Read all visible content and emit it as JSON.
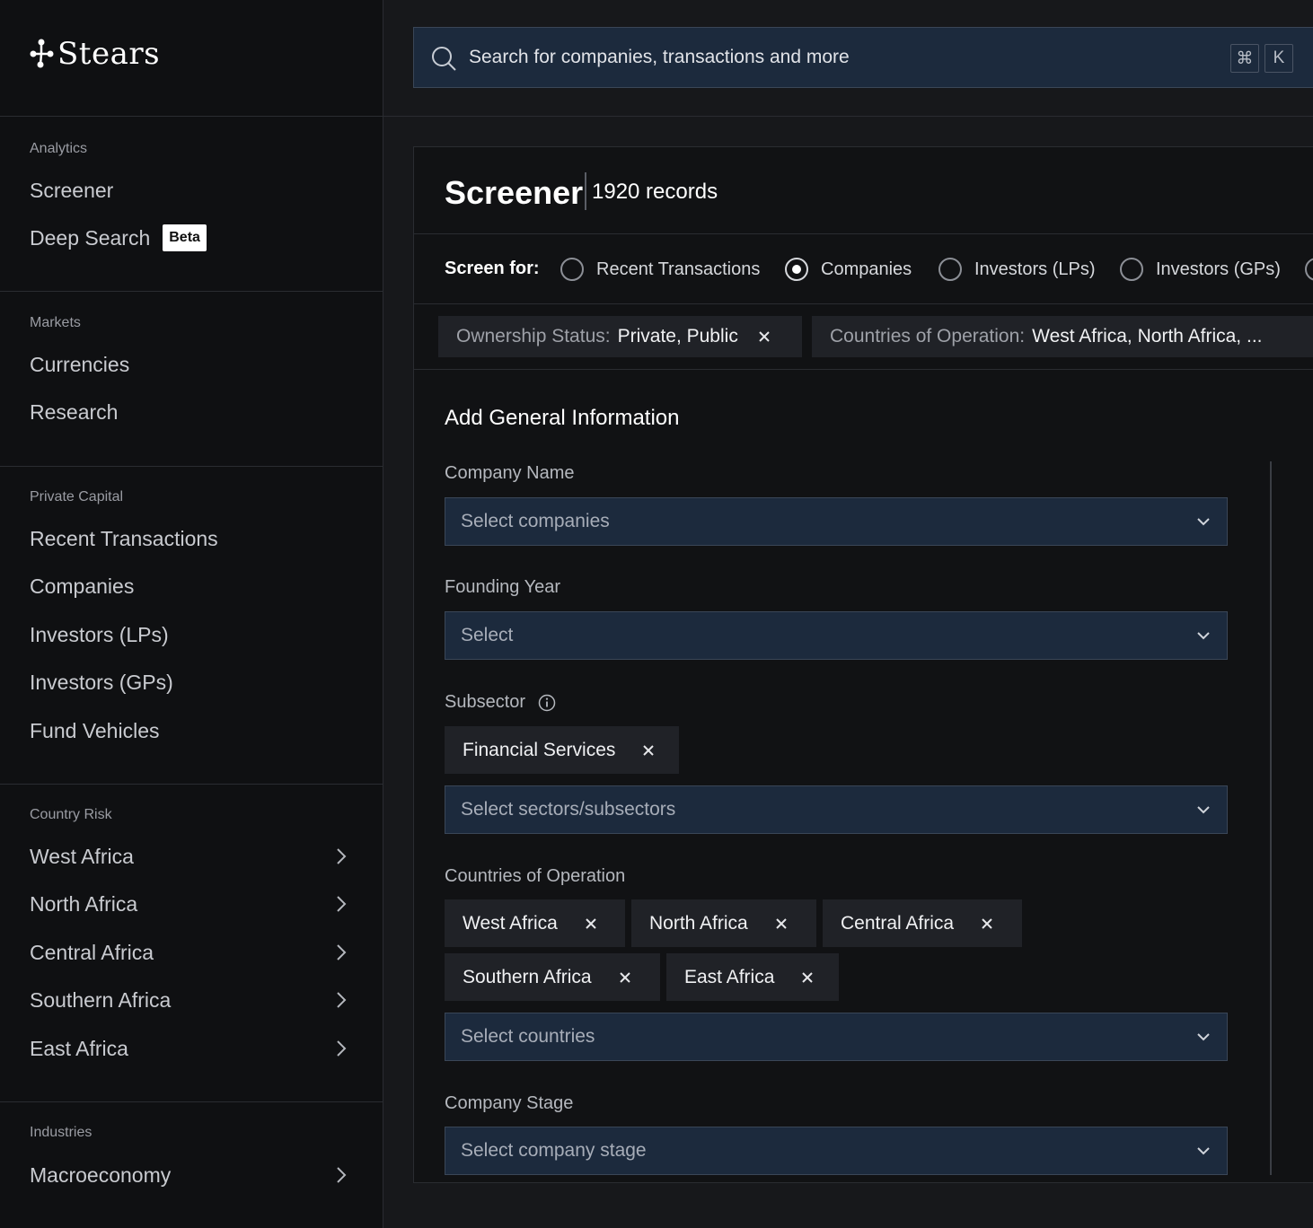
{
  "brand": {
    "name": "Stears"
  },
  "sidebar": {
    "sections": [
      {
        "label": "Analytics",
        "items": [
          {
            "label": "Screener"
          },
          {
            "label": "Deep Search",
            "badge": "Beta"
          }
        ]
      },
      {
        "label": "Markets",
        "items": [
          {
            "label": "Currencies"
          },
          {
            "label": "Research"
          }
        ]
      },
      {
        "label": "Private Capital",
        "items": [
          {
            "label": "Recent Transactions"
          },
          {
            "label": "Companies"
          },
          {
            "label": "Investors (LPs)"
          },
          {
            "label": "Investors (GPs)"
          },
          {
            "label": "Fund Vehicles"
          }
        ]
      },
      {
        "label": "Country Risk",
        "items": [
          {
            "label": "West Africa",
            "icon": "chevron-right-icon"
          },
          {
            "label": "North Africa",
            "icon": "chevron-right-icon"
          },
          {
            "label": "Central Africa",
            "icon": "chevron-right-icon"
          },
          {
            "label": "Southern Africa",
            "icon": "chevron-right-icon"
          },
          {
            "label": "East Africa",
            "icon": "chevron-right-icon"
          }
        ]
      },
      {
        "label": "Industries",
        "items": [
          {
            "label": "Macroeconomy",
            "icon": "chevron-right-icon"
          }
        ]
      }
    ]
  },
  "search": {
    "placeholder": "Search for companies, transactions and more",
    "shortcut_keys": [
      "⌘",
      "K"
    ]
  },
  "screener": {
    "title": "Screener",
    "records": "1920 records",
    "screen_for_label": "Screen for:",
    "options": [
      {
        "label": "Recent Transactions",
        "checked": false
      },
      {
        "label": "Companies",
        "checked": true
      },
      {
        "label": "Investors (LPs)",
        "checked": false
      },
      {
        "label": "Investors (GPs)",
        "checked": false
      }
    ],
    "active_filters": [
      {
        "key": "Ownership Status:",
        "value": "Private, Public"
      },
      {
        "key": "Countries of Operation:",
        "value": "West Africa, North Africa, ..."
      }
    ]
  },
  "form": {
    "title": "Add General Information",
    "company_name": {
      "label": "Company Name",
      "placeholder": "Select companies"
    },
    "founding_year": {
      "label": "Founding Year",
      "placeholder": "Select"
    },
    "subsector": {
      "label": "Subsector",
      "tags": [
        "Financial Services"
      ],
      "placeholder": "Select sectors/subsectors"
    },
    "countries": {
      "label": "Countries of Operation",
      "tags": [
        "West Africa",
        "North Africa",
        "Central Africa",
        "Southern Africa",
        "East Africa"
      ],
      "placeholder": "Select countries"
    },
    "company_stage": {
      "label": "Company Stage",
      "placeholder": "Select company stage"
    }
  },
  "colors": {
    "background": "#17181b",
    "sidebar": "#0f1012",
    "input_fill": "#1c2a3d",
    "chip_fill": "#202227"
  }
}
